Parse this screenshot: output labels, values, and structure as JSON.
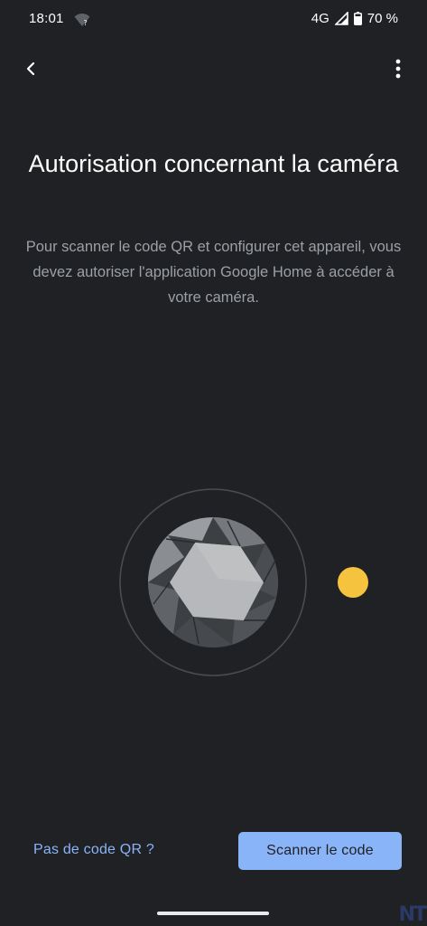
{
  "status_bar": {
    "time": "18:01",
    "network": "4G",
    "battery": "70 %",
    "wifi_icon": "wifi-unknown-icon",
    "signal_icon": "signal-icon",
    "battery_icon": "battery-icon"
  },
  "app_bar": {
    "back_icon": "chevron-left-icon",
    "menu_icon": "more-vert-icon"
  },
  "main": {
    "title": "Autorisation concernant la caméra",
    "description": "Pour scanner le code QR et configurer cet appareil, vous devez autoriser l'application Google Home à accéder à votre caméra.",
    "illustration_icon": "camera-lens-icon",
    "accent_dot_color": "#f6c33e"
  },
  "footer": {
    "no_qr_link": "Pas de code QR ?",
    "scan_button": "Scanner le code",
    "button_color": "#8ab4f8"
  },
  "watermark": "NT"
}
